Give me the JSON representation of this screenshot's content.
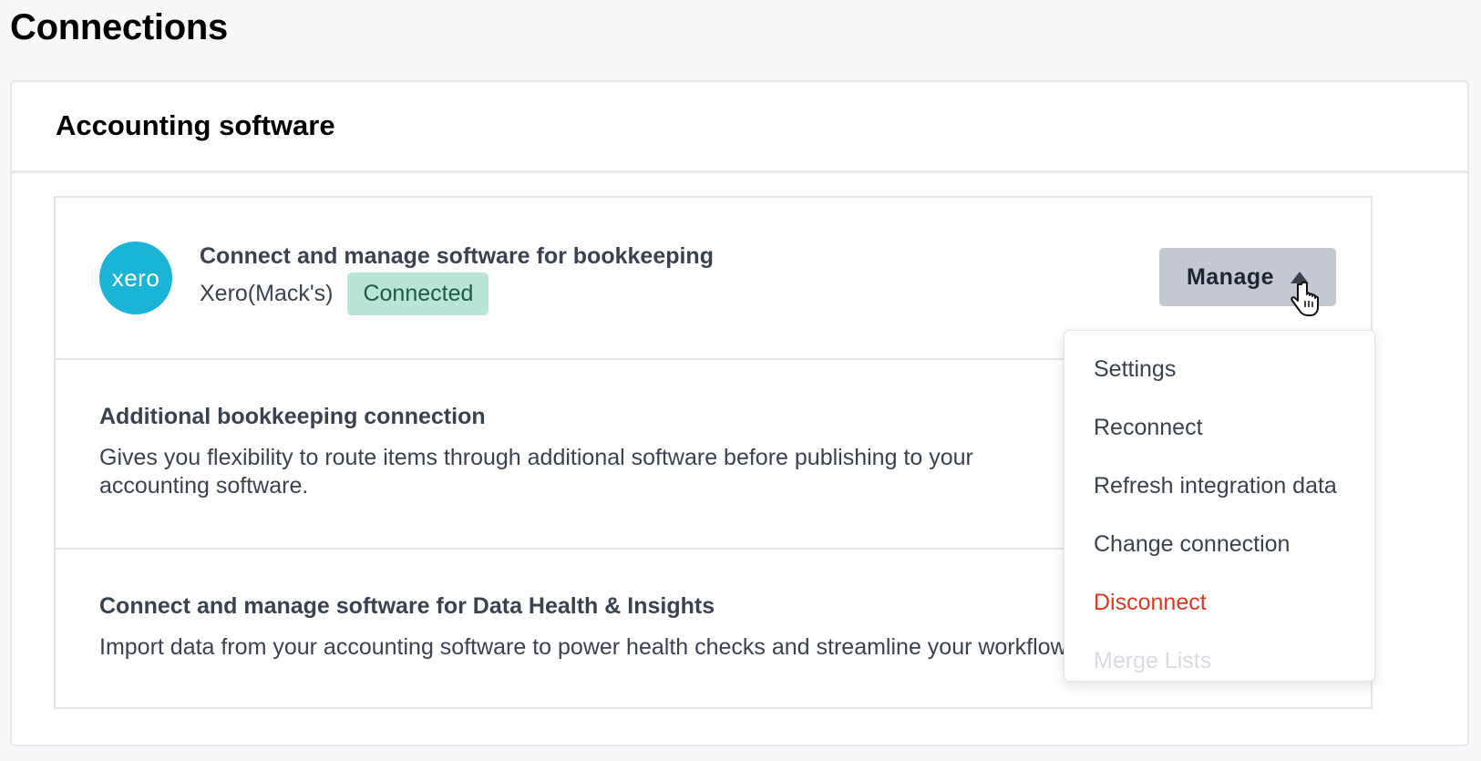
{
  "page": {
    "title": "Connections"
  },
  "card": {
    "title": "Accounting software"
  },
  "primary_connection": {
    "logo_text": "xero",
    "title": "Connect and manage software for bookkeeping",
    "org_name": "Xero(Mack's)",
    "status": "Connected",
    "manage_label": "Manage"
  },
  "additional_connection": {
    "title": "Additional bookkeeping connection",
    "description": "Gives you flexibility to route items through additional software before publishing to your accounting software."
  },
  "insights_connection": {
    "title": "Connect and manage software for Data Health & Insights",
    "description": "Import data from your accounting software to power health checks and streamline your workflows."
  },
  "manage_menu": {
    "items": [
      {
        "label": "Settings"
      },
      {
        "label": "Reconnect"
      },
      {
        "label": "Refresh integration data"
      },
      {
        "label": "Change connection"
      },
      {
        "label": "Disconnect"
      },
      {
        "label": "Merge Lists"
      }
    ]
  },
  "colors": {
    "xero_brand": "#1ab4d7",
    "status_bg": "#b8e5d6",
    "danger": "#d53b22",
    "manage_button": "#c3c8d1"
  }
}
